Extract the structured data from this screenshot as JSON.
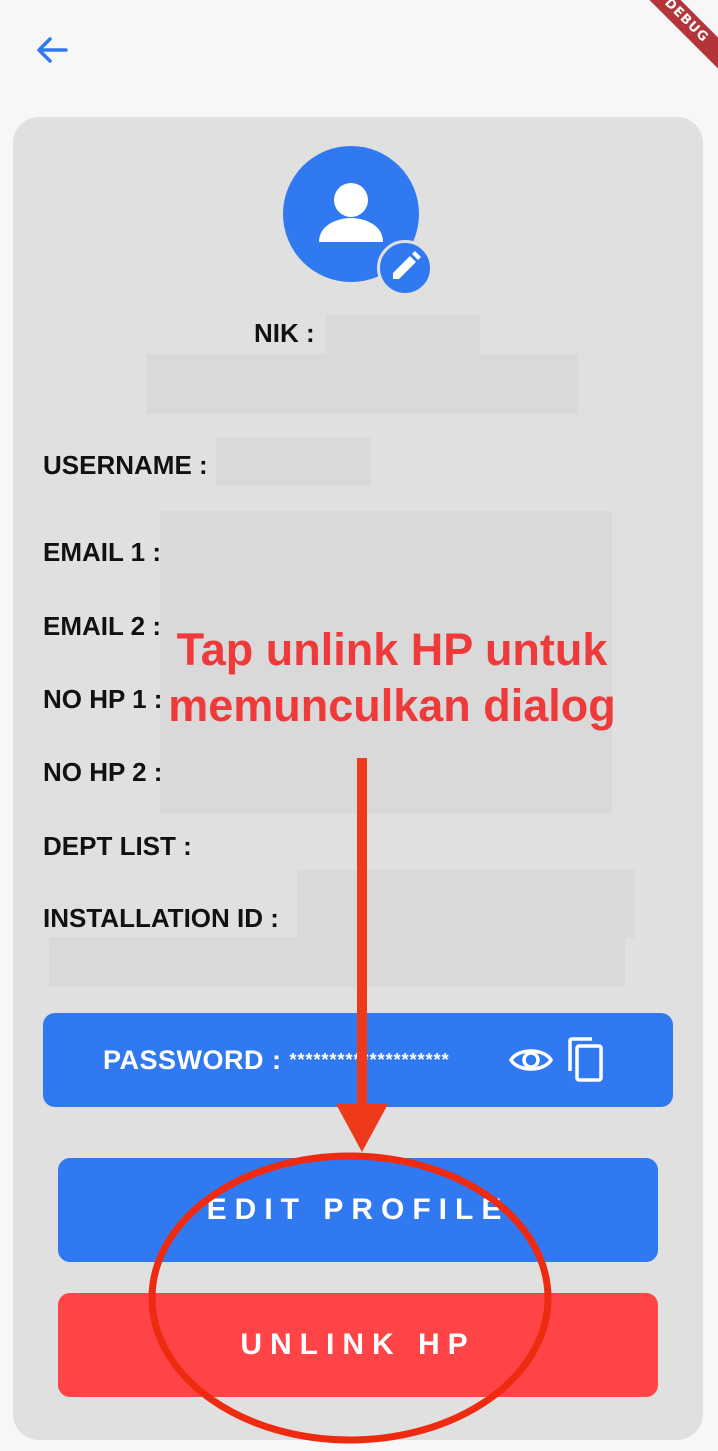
{
  "debug_banner": "DEBUG",
  "profile": {
    "nik_label": "NIK :",
    "username_label": "USERNAME :",
    "email1_label": "EMAIL 1 :",
    "email2_label": "EMAIL 2 :",
    "nohp1_label": "NO HP 1 :",
    "nohp2_label": "NO HP 2 :",
    "dept_label": "DEPT LIST :",
    "installation_label": "INSTALLATION ID :"
  },
  "password": {
    "label": "PASSWORD :",
    "masked_value": "********************"
  },
  "buttons": {
    "edit_profile": "EDIT PROFILE",
    "unlink_hp": "UNLINK HP"
  },
  "annotation": {
    "line1": "Tap unlink HP untuk",
    "line2": "memunculkan dialog",
    "color": "#ee3a3a"
  },
  "colors": {
    "primary": "#3079f0",
    "danger": "#ff4447",
    "card": "#e0e0e0"
  },
  "icons": [
    "back-arrow-icon",
    "person-icon",
    "pencil-icon",
    "eye-icon",
    "copy-icon"
  ]
}
